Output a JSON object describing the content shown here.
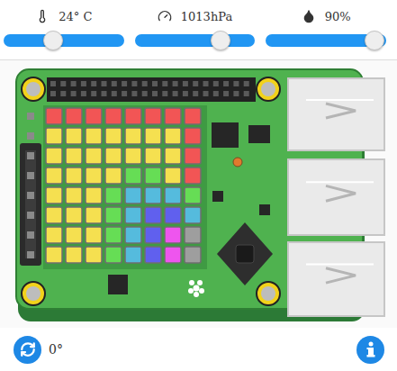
{
  "sensors": [
    {
      "kind": "temperature",
      "reading": "24° C",
      "level": 0.41
    },
    {
      "kind": "pressure",
      "reading": "1013hPa",
      "level": 0.71
    },
    {
      "kind": "humidity",
      "reading": "90%",
      "level": 0.9
    }
  ],
  "led_matrix": {
    "rows": [
      [
        "#f25555",
        "#f25555",
        "#f25555",
        "#f25555",
        "#f25555",
        "#f25555",
        "#f25555",
        "#f25555"
      ],
      [
        "#f5e050",
        "#f5e050",
        "#f5e050",
        "#f5e050",
        "#f5e050",
        "#f5e050",
        "#f5e050",
        "#f25555"
      ],
      [
        "#f5e050",
        "#f5e050",
        "#f5e050",
        "#f5e050",
        "#f5e050",
        "#f5e050",
        "#f5e050",
        "#f25555"
      ],
      [
        "#f5e050",
        "#f5e050",
        "#f5e050",
        "#f5e050",
        "#66dd55",
        "#66dd55",
        "#f5e050",
        "#f25555"
      ],
      [
        "#f5e050",
        "#f5e050",
        "#f5e050",
        "#66dd55",
        "#55bbdd",
        "#55bbdd",
        "#55bbdd",
        "#66dd55"
      ],
      [
        "#f5e050",
        "#f5e050",
        "#f5e050",
        "#66dd55",
        "#55bbdd",
        "#6060ee",
        "#6060ee",
        "#55bbdd"
      ],
      [
        "#f5e050",
        "#f5e050",
        "#f5e050",
        "#66dd55",
        "#55bbdd",
        "#6060ee",
        "#ee55ee",
        "#9e9e9e"
      ],
      [
        "#f5e050",
        "#f5e050",
        "#f5e050",
        "#66dd55",
        "#55bbdd",
        "#6060ee",
        "#ee55ee",
        "#9e9e9e"
      ]
    ]
  },
  "rotation": {
    "reading": "0°"
  }
}
